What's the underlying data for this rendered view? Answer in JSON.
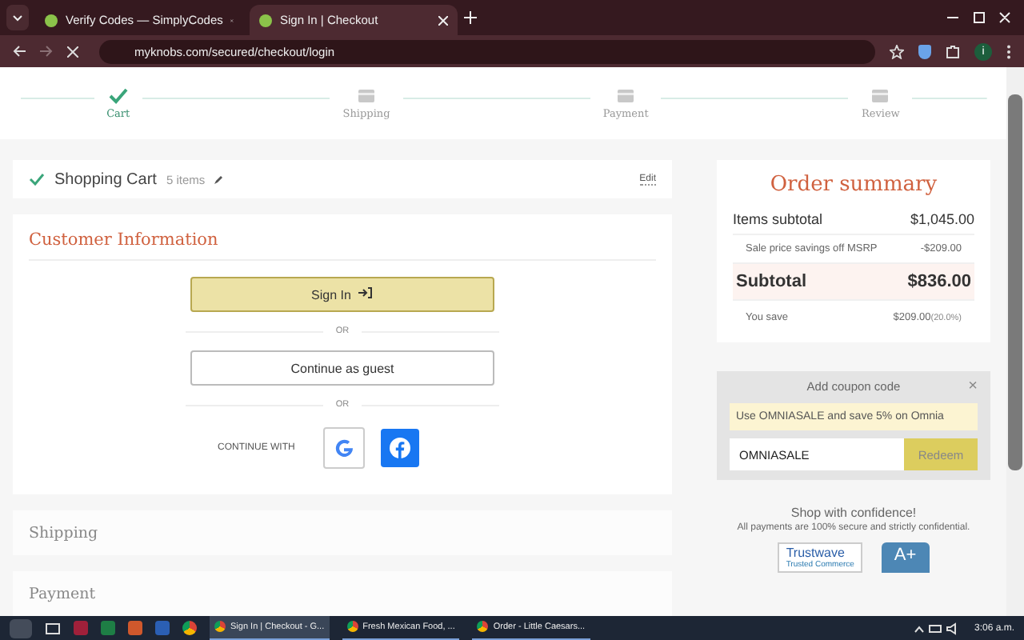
{
  "browser": {
    "tabs": [
      {
        "title": "Verify Codes — SimplyCodes",
        "selected": false
      },
      {
        "title": "Sign In | Checkout",
        "selected": true
      }
    ],
    "url": "myknobs.com/secured/checkout/login",
    "profile_initial": "i"
  },
  "steps": [
    {
      "label": "Cart",
      "done": true
    },
    {
      "label": "Shipping",
      "done": false
    },
    {
      "label": "Payment",
      "done": false
    },
    {
      "label": "Review",
      "done": false
    }
  ],
  "cart": {
    "title": "Shopping Cart",
    "count": "5 items",
    "edit": "Edit"
  },
  "customer": {
    "title": "Customer Information",
    "sign_in": "Sign In",
    "or_1": "OR",
    "guest": "Continue as guest",
    "or_2": "OR",
    "continue_with": "CONTINUE WITH"
  },
  "sections": [
    "Shipping",
    "Payment"
  ],
  "summary": {
    "title": "Order summary",
    "rows": [
      {
        "kind": "main",
        "label": "Items subtotal",
        "value": "$1,045.00"
      },
      {
        "kind": "minor",
        "label": "Sale price savings off MSRP",
        "value": "-$209.00"
      },
      {
        "kind": "total",
        "label": "Subtotal",
        "value": "$836.00"
      },
      {
        "kind": "save",
        "label": "You save",
        "value": "$209.00",
        "note": "(20.0%)"
      }
    ]
  },
  "coupon": {
    "title": "Add coupon code",
    "close": "×",
    "promo": "Use OMNIASALE and save 5% on Omnia",
    "value": "OMNIASALE",
    "button": "Redeem"
  },
  "confidence": {
    "title": "Shop with confidence!",
    "text": "All payments are 100% secure and strictly confidential.",
    "trust_1": "Trustwave",
    "trust_2": "Trusted Commerce",
    "bbb": "A+"
  },
  "taskbar": {
    "windows": [
      {
        "title": "Sign In | Checkout - G...",
        "selected": true
      },
      {
        "title": "Fresh Mexican Food, ...",
        "selected": false
      },
      {
        "title": "Order - Little Caesars...",
        "selected": false
      }
    ],
    "time": "3:06 a.m."
  }
}
